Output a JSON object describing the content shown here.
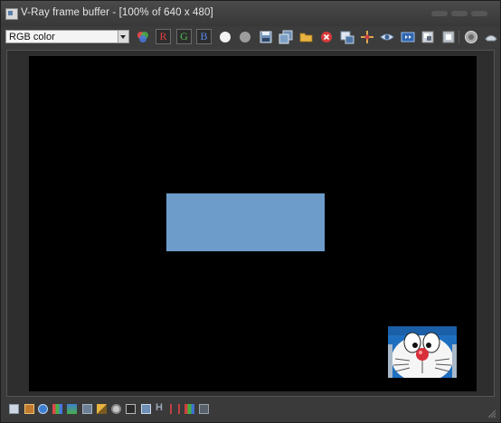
{
  "window": {
    "title": "V-Ray frame buffer - [100% of 640 x 480]"
  },
  "toolbar": {
    "channel_select_value": "RGB color",
    "channel_buttons": [
      "R",
      "G",
      "B"
    ],
    "icons": [
      "color-picker-icon",
      "show-red-channel",
      "show-green-channel",
      "show-blue-channel",
      "show-alpha-icon",
      "monochrome-icon",
      "save-image-icon",
      "save-all-icon",
      "load-image-icon",
      "clear-image-icon",
      "duplicate-to-vfb-icon",
      "track-mouse-icon",
      "region-render-icon",
      "last-render-icon",
      "link-to-render-icon",
      "stop-render-icon",
      "render-icon"
    ]
  },
  "statusbar": {
    "text_h": "H",
    "icons": [
      "display-color-correction-icon",
      "lens-effects-icon",
      "info-icon",
      "compare-icon",
      "levels-icon",
      "curves-icon",
      "exposure-icon",
      "white-balance-icon",
      "lut-icon",
      "srgb-icon",
      "hsv-icon",
      "histogram-icon",
      "stamp-icon"
    ]
  },
  "colors": {
    "window_bg": "#3a3a3a",
    "canvas_bg": "#000000",
    "rendered_rect": "#6d9ccb",
    "doraemon_blue": "#1f6fc0",
    "doraemon_nose": "#d8303a"
  }
}
